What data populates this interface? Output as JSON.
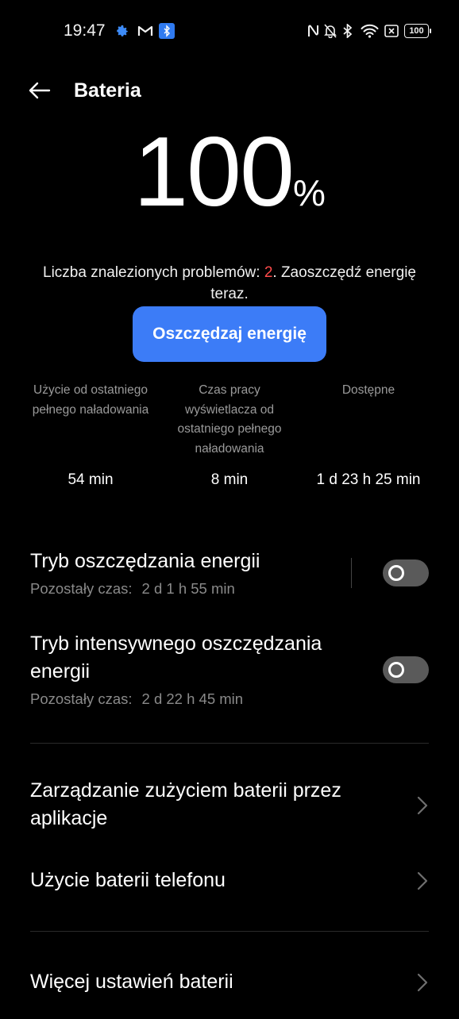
{
  "status_bar": {
    "time": "19:47",
    "battery_level": "100",
    "left_icons": [
      "gear-icon",
      "gmail-icon",
      "bluetooth-app-icon"
    ],
    "right_icons": [
      "nfc-icon",
      "bell-off-icon",
      "bluetooth-icon",
      "wifi-icon",
      "sim-off-icon",
      "battery-icon"
    ]
  },
  "header": {
    "title": "Bateria"
  },
  "battery": {
    "percent": "100",
    "unit": "%"
  },
  "problems": {
    "prefix": "Liczba znalezionych problemów: ",
    "count": "2",
    "suffix": ". Zaoszczędź energię teraz."
  },
  "save_button": {
    "label": "Oszczędzaj energię"
  },
  "stats": [
    {
      "label": "Użycie od ostatniego pełnego naładowania",
      "value": "54 min"
    },
    {
      "label": "Czas pracy wyświetlacza od ostatniego pełnego naładowania",
      "value": "8 min"
    },
    {
      "label": "Dostępne",
      "value": "1 d 23 h 25 min"
    }
  ],
  "power_saving": {
    "title": "Tryb oszczędzania energii",
    "remaining_label": "Pozostały czas:",
    "remaining_value": "2 d 1 h 55 min",
    "enabled": false
  },
  "ultra_saving": {
    "title_line1": "Tryb intensywnego oszczędzania",
    "title_line2": "energii",
    "remaining_label": "Pozostały czas:",
    "remaining_value": "2 d 22 h 45 min",
    "enabled": false
  },
  "nav_items": [
    {
      "line1": "Zarządzanie zużyciem baterii przez",
      "line2": "aplikacje"
    },
    {
      "line1": "Użycie baterii telefonu"
    },
    {
      "line1": "Więcej ustawień baterii"
    }
  ],
  "colors": {
    "background": "#000000",
    "accent": "#3c7cf7",
    "alert": "#ff4b4b",
    "secondary_text": "#8a8a8a",
    "toggle_off": "#5a5a5a"
  }
}
